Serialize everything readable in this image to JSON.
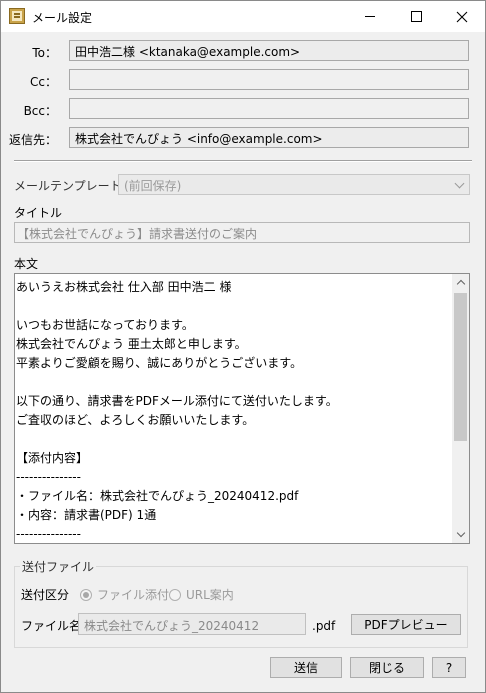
{
  "window": {
    "title": "メール設定"
  },
  "fields": {
    "to_label": "To：",
    "to_value": "田中浩二様 <ktanaka@example.com>",
    "cc_label": "Cc：",
    "cc_value": "",
    "bcc_label": "Bcc：",
    "bcc_value": "",
    "reply_label": "返信先：",
    "reply_value": "株式会社でんぴょう <info@example.com>"
  },
  "template": {
    "label": "メールテンプレート：",
    "selected": "(前回保存)"
  },
  "subject": {
    "label": "タイトル",
    "value": "【株式会社でんぴょう】請求書送付のご案内"
  },
  "body": {
    "label": "本文",
    "lines": [
      "あいうえお株式会社 仕入部 田中浩二 様",
      "",
      "いつもお世話になっております。",
      "株式会社でんぴょう 亜土太郎と申します。",
      "平素よりご愛顧を賜り、誠にありがとうございます。",
      "",
      "以下の通り、請求書をPDFメール添付にて送付いたします。",
      "ご査収のほど、よろしくお願いいたします。",
      "",
      "【添付内容】",
      "---------------",
      "・ファイル名：株式会社でんぴょう_20240412.pdf",
      "・内容：請求書(PDF) 1通",
      "---------------"
    ]
  },
  "attachment": {
    "group_label": "送付ファイル",
    "mode_label": "送付区分",
    "option_attach": "ファイル添付",
    "option_url": "URL案内",
    "selected_option": "ファイル添付",
    "filename_label": "ファイル名",
    "filename_value": "株式会社でんぴょう_20240412",
    "extension": ".pdf",
    "preview_button": "PDFプレビュー"
  },
  "footer": {
    "send_button": "送信",
    "close_button": "閉じる",
    "help_button": "?"
  }
}
